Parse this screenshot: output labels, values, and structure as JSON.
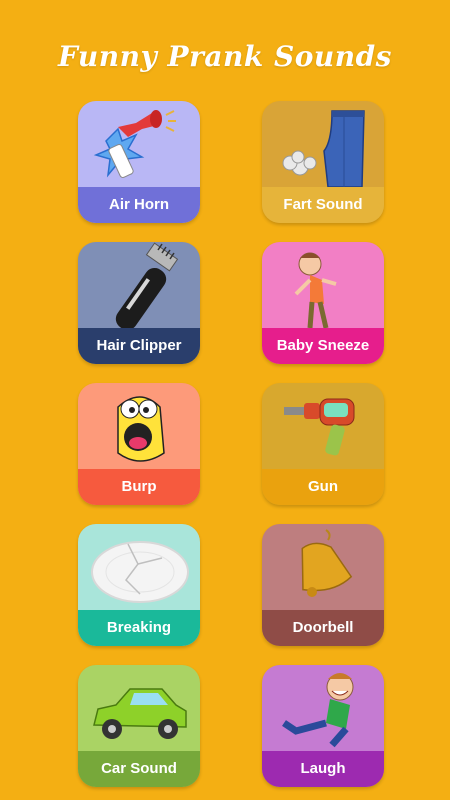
{
  "app": {
    "title": "Funny Prank Sounds"
  },
  "colors": {
    "background": "#F4AF13"
  },
  "sounds": [
    {
      "label": "Air Horn",
      "icon": "air-horn-icon",
      "bg": "#B9B7F5",
      "bar": "#7070D8"
    },
    {
      "label": "Fart Sound",
      "icon": "fart-icon",
      "bg": "#D9A437",
      "bar": "#E6B43A"
    },
    {
      "label": "Hair Clipper",
      "icon": "hair-clipper-icon",
      "bg": "#7F8FB6",
      "bar": "#2A3E6C"
    },
    {
      "label": "Baby Sneeze",
      "icon": "sneeze-icon",
      "bg": "#F27FC5",
      "bar": "#E61E8C"
    },
    {
      "label": "Burp",
      "icon": "burp-icon",
      "bg": "#FD9A7A",
      "bar": "#F65A3E"
    },
    {
      "label": "Gun",
      "icon": "ray-gun-icon",
      "bg": "#D8A82E",
      "bar": "#EAA20E"
    },
    {
      "label": "Breaking",
      "icon": "broken-plate-icon",
      "bg": "#A9E5DA",
      "bar": "#1AB99A"
    },
    {
      "label": "Doorbell",
      "icon": "bell-icon",
      "bg": "#BE7E7F",
      "bar": "#8F4C47"
    },
    {
      "label": "Car Sound",
      "icon": "car-icon",
      "bg": "#AAD364",
      "bar": "#77A83A"
    },
    {
      "label": "Laugh",
      "icon": "laugh-icon",
      "bg": "#C57BD2",
      "bar": "#9D2AB0"
    }
  ]
}
